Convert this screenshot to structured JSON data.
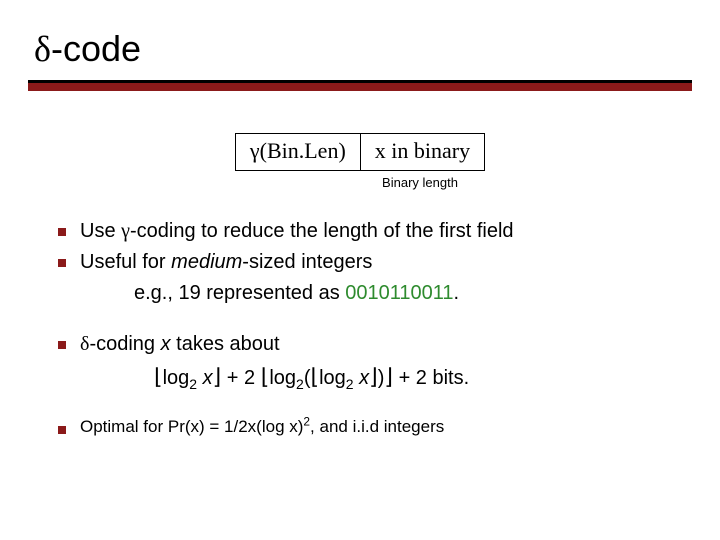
{
  "title": {
    "delta": "δ",
    "rest": "-code"
  },
  "table": {
    "cell1_prefix": "γ",
    "cell1_rest": "(Bin.Len)",
    "cell2": "x in binary"
  },
  "caption": "Binary length",
  "bullets": {
    "b1_pre": "Use ",
    "b1_sym": "γ",
    "b1_post": "-coding to reduce the length of the first field",
    "b2_pre": "Useful for ",
    "b2_it": "medium",
    "b2_post": "-sized integers",
    "b2_sub_pre": "e.g., 19 represented as ",
    "b2_sub_code": "0010110011",
    "b2_sub_post": ".",
    "b3_sym": "δ",
    "b3_post1": "-coding  ",
    "b3_x": "x",
    "b3_post2": " takes about",
    "formula": "⌊log₂ x⌋ + 2 ⌊log₂(⌊log₂ x⌋)⌋ + 2 bits.",
    "b4_pre": "Optimal for Pr(x) = 1/2x(log x)",
    "b4_sup": "2",
    "b4_post": ", and i.i.d integers"
  }
}
